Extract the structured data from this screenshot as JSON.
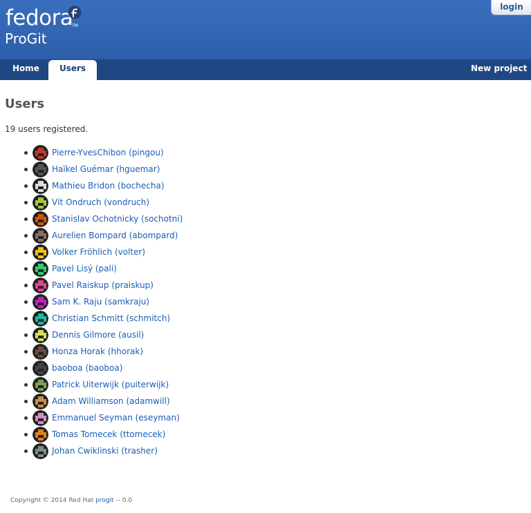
{
  "header": {
    "logo_text": "fedora",
    "logo_tm": "TM",
    "app_name": "ProGit",
    "login_label": "login"
  },
  "nav": {
    "home": "Home",
    "users": "Users",
    "new_project": "New project"
  },
  "page": {
    "title": "Users",
    "count_text": "19 users registered."
  },
  "users": [
    {
      "label": "Pierre-YvesChibon (pingou)",
      "avatar_color": "#c0392b"
    },
    {
      "label": "Haïkel Guémar (hguemar)",
      "avatar_color": "#555555"
    },
    {
      "label": "Mathieu Bridon (bochecha)",
      "avatar_color": "#dddddd"
    },
    {
      "label": "Vít Ondruch (vondruch)",
      "avatar_color": "#a3c93a"
    },
    {
      "label": "Stanislav Ochotnicky (sochotni)",
      "avatar_color": "#d35400"
    },
    {
      "label": "Aurelien Bompard (abompard)",
      "avatar_color": "#8d6e63"
    },
    {
      "label": "Volker Fröhlich (volter)",
      "avatar_color": "#f1c40f"
    },
    {
      "label": "Pavel Lisý (pali)",
      "avatar_color": "#2ecc71"
    },
    {
      "label": "Pavel Raiskup (praiskup)",
      "avatar_color": "#e84393"
    },
    {
      "label": "Sam K. Raju (samkraju)",
      "avatar_color": "#c71cc7"
    },
    {
      "label": "Christian Schmitt (schmitch)",
      "avatar_color": "#1abc9c"
    },
    {
      "label": "Dennis Gilmore (ausil)",
      "avatar_color": "#d4e157"
    },
    {
      "label": "Honza Horak (hhorak)",
      "avatar_color": "#6d4c41"
    },
    {
      "label": "baoboa (baoboa)",
      "avatar_color": "#444444"
    },
    {
      "label": "Patrick Uiterwijk (puiterwijk)",
      "avatar_color": "#7da453"
    },
    {
      "label": "Adam Williamson (adamwill)",
      "avatar_color": "#c8913f"
    },
    {
      "label": "Emmanuel Seyman (eseyman)",
      "avatar_color": "#d88ac8"
    },
    {
      "label": "Tomas Tomecek (ttomecek)",
      "avatar_color": "#e67e22"
    },
    {
      "label": "Johan Cwiklinski (trasher)",
      "avatar_color": "#7f8c8d"
    }
  ],
  "footer": {
    "copyright": "Copyright © 2014 Red Hat",
    "link": "progit",
    "version": "-- 0.0"
  }
}
